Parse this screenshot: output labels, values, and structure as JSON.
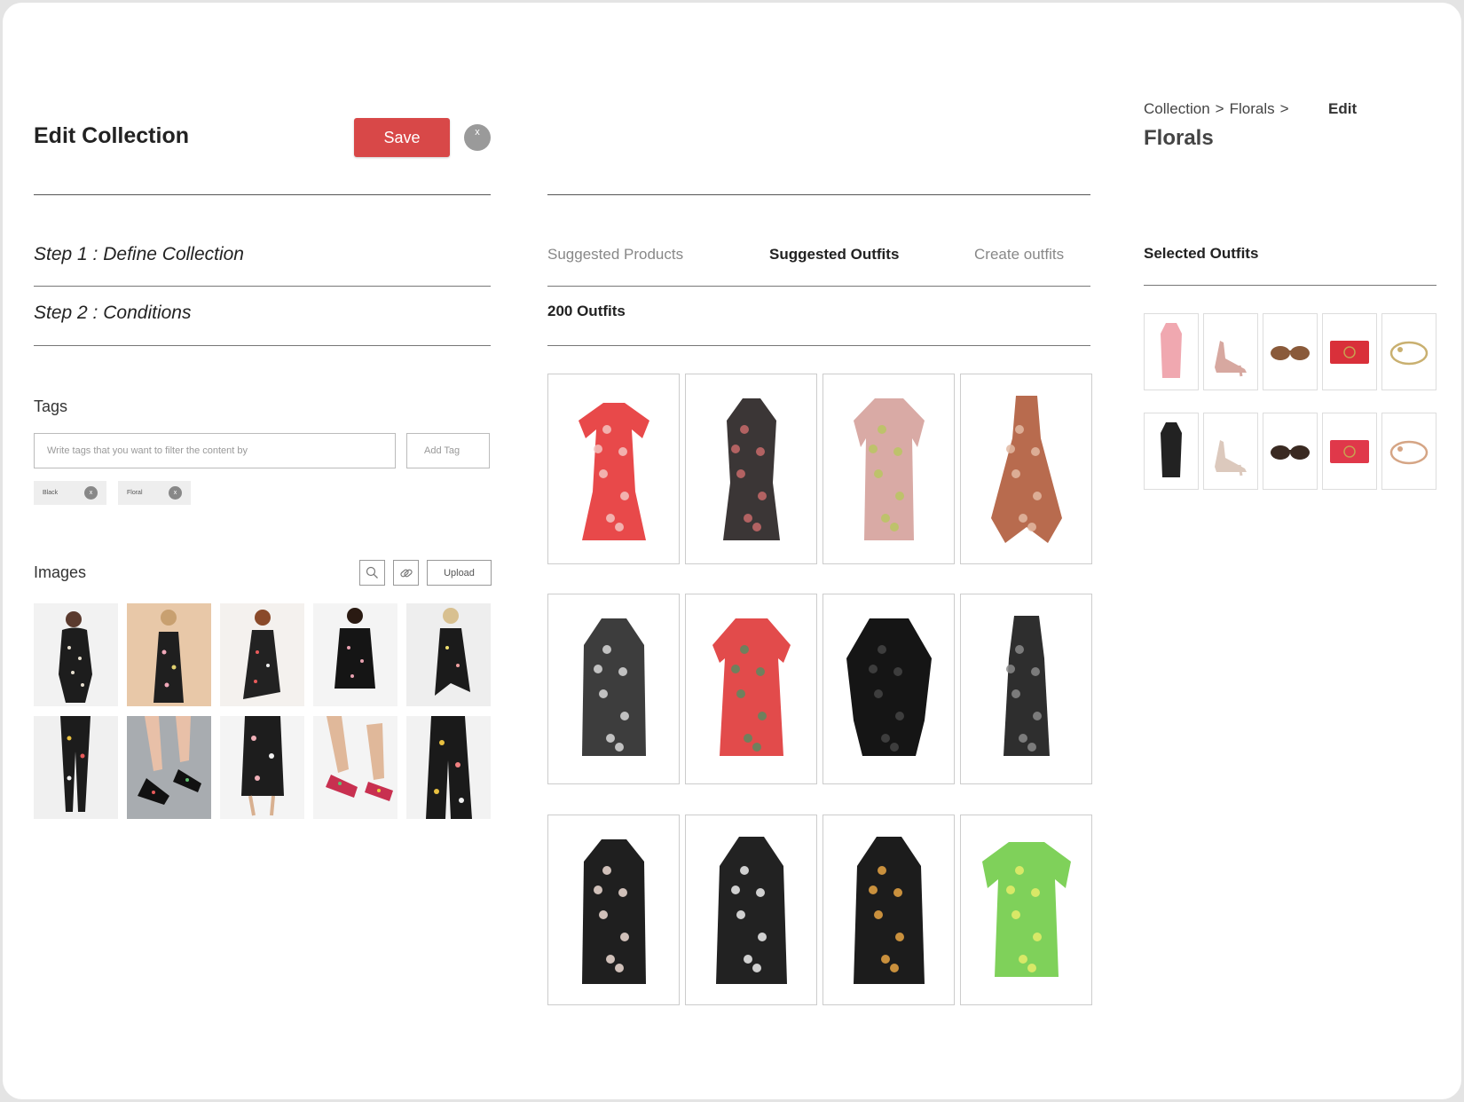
{
  "header": {
    "title": "Edit Collection",
    "save_label": "Save",
    "close_label": "x"
  },
  "steps": {
    "step1_prefix": "Step 1 :",
    "step1_name": "Define Collection",
    "step2_prefix": "Step 2 :",
    "step2_name": "Conditions"
  },
  "tags": {
    "label": "Tags",
    "placeholder": "Write tags that you want to filter the content by",
    "add_label": "Add Tag",
    "chips": [
      {
        "label": "Black",
        "remove": "x"
      },
      {
        "label": "Floral",
        "remove": "x"
      }
    ]
  },
  "images": {
    "label": "Images",
    "upload_label": "Upload",
    "icons": [
      "search-icon",
      "link-icon"
    ],
    "thumbnails": [
      "black floral top model",
      "black floral slip dress model",
      "black floral wrap dress model",
      "black floral mini dress model",
      "black floral asymmetric dress model",
      "black floral trousers model",
      "floral block heel sandals",
      "black floral culottes",
      "floral slingback heels",
      "black floral wide trousers"
    ]
  },
  "tabs": [
    {
      "label": "Suggested Products",
      "active": false
    },
    {
      "label": "Suggested Outfits",
      "active": true
    },
    {
      "label": "Create outfits",
      "active": false
    }
  ],
  "outfits": {
    "count_label": "200 Outfits",
    "items": [
      {
        "name": "red floral wrap dress",
        "color": "#e8494a",
        "pattern": "#f3c3c0"
      },
      {
        "name": "black red floral shirt dress",
        "color": "#3b3636",
        "pattern": "#c86a6a"
      },
      {
        "name": "pink floral shift dress",
        "color": "#d9aaa5",
        "pattern": "#b8c760"
      },
      {
        "name": "rust paisley handkerchief dress",
        "color": "#b86b4e",
        "pattern": "#e2b9a2"
      },
      {
        "name": "sheer polka dot dress",
        "color": "#3d3d3d",
        "pattern": "#d8d8d8"
      },
      {
        "name": "red tropical print dress",
        "color": "#e24b4b",
        "pattern": "#5a8a60"
      },
      {
        "name": "black lace cape dress",
        "color": "#151515",
        "pattern": "#444444"
      },
      {
        "name": "black tweed sleeveless dress",
        "color": "#2e2e2e",
        "pattern": "#888888"
      },
      {
        "name": "black white floral maxi dress",
        "color": "#1f1f1f",
        "pattern": "#f0ddd5"
      },
      {
        "name": "zebra print shirt dress",
        "color": "#222222",
        "pattern": "#eeeeee"
      },
      {
        "name": "black floral midi dress",
        "color": "#1c1c1c",
        "pattern": "#e8a443"
      },
      {
        "name": "green yellow ombre dress",
        "color": "#7fd15a",
        "pattern": "#e8ec6a"
      }
    ]
  },
  "breadcrumb": {
    "items": [
      "Collection",
      ">",
      "Florals",
      ">"
    ],
    "current": "Edit",
    "collection_name": "Florals"
  },
  "selected": {
    "title": "Selected Outfits",
    "rows": [
      [
        {
          "name": "pink tiered maxi dress",
          "icon": "dress-icon",
          "color": "#f0a8b0"
        },
        {
          "name": "pink strappy heel",
          "icon": "shoe-icon",
          "color": "#d7a8a0"
        },
        {
          "name": "tortoise sunglasses",
          "icon": "sunglasses-icon",
          "color": "#8a5a3a"
        },
        {
          "name": "red clutch",
          "icon": "bag-icon",
          "color": "#d9303a"
        },
        {
          "name": "gold chain bracelet",
          "icon": "bracelet-icon",
          "color": "#c9b070"
        }
      ],
      [
        {
          "name": "black white floral dress",
          "icon": "dress-icon",
          "color": "#222222"
        },
        {
          "name": "nude strappy sandal",
          "icon": "shoe-icon",
          "color": "#dcc9bd"
        },
        {
          "name": "dark sunglasses",
          "icon": "sunglasses-icon",
          "color": "#3a2a22"
        },
        {
          "name": "red quilted clutch",
          "icon": "bag-icon",
          "color": "#e0384a"
        },
        {
          "name": "rose gold bracelet",
          "icon": "bracelet-icon",
          "color": "#d5a585"
        }
      ]
    ]
  }
}
